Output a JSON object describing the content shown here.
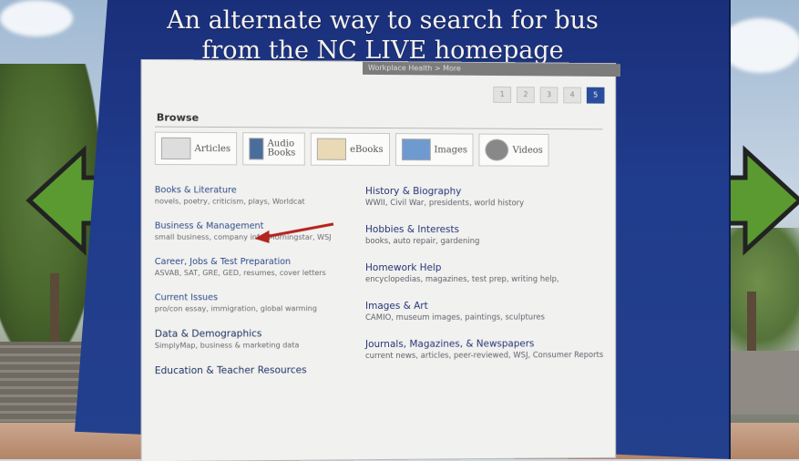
{
  "headline": {
    "line1": "An alternate way to search for bus",
    "line2": "from the NC LIVE homepage"
  },
  "page": {
    "topbar_label": "Workplace Health > More",
    "pager": [
      "1",
      "2",
      "3",
      "4",
      "5"
    ],
    "active_page": "5",
    "browse_label": "Browse",
    "tiles": [
      {
        "label": "Articles",
        "icon": "articles-icon"
      },
      {
        "label": "Audio Books",
        "icon": "audiobooks-icon"
      },
      {
        "label": "eBooks",
        "icon": "ebooks-icon"
      },
      {
        "label": "Images",
        "icon": "images-icon"
      },
      {
        "label": "Videos",
        "icon": "videos-icon"
      }
    ],
    "left_categories": [
      {
        "title": "Books & Literature",
        "desc": "novels, poetry, criticism, plays, Worldcat"
      },
      {
        "title": "Business & Management",
        "desc": "small business, company info, Morningstar, WSJ"
      },
      {
        "title": "Career, Jobs & Test Preparation",
        "desc": "ASVAB, SAT, GRE, GED, resumes, cover letters"
      },
      {
        "title": "Current Issues",
        "desc": "pro/con essay, immigration, global warming"
      },
      {
        "title": "Data & Demographics",
        "desc": "SimplyMap, business & marketing data"
      },
      {
        "title": "Education & Teacher Resources",
        "desc": ""
      }
    ],
    "right_categories": [
      {
        "title": "History & Biography",
        "desc": "WWII, Civil War, presidents, world history"
      },
      {
        "title": "Hobbies & Interests",
        "desc": "books, auto repair, gardening"
      },
      {
        "title": "Homework Help",
        "desc": "encyclopedias, magazines, test prep, writing help,"
      },
      {
        "title": "Images & Art",
        "desc": "CAMIO, museum images, paintings, sculptures"
      },
      {
        "title": "Journals, Magazines, & Newspapers",
        "desc": "current news, articles, peer-reviewed, WSJ, Consumer Reports"
      }
    ]
  },
  "colors": {
    "board_blue": "#203c8c",
    "link_blue": "#2d4a8a",
    "arrow_green": "#4f8a2b",
    "pointer_red": "#b3231f"
  }
}
